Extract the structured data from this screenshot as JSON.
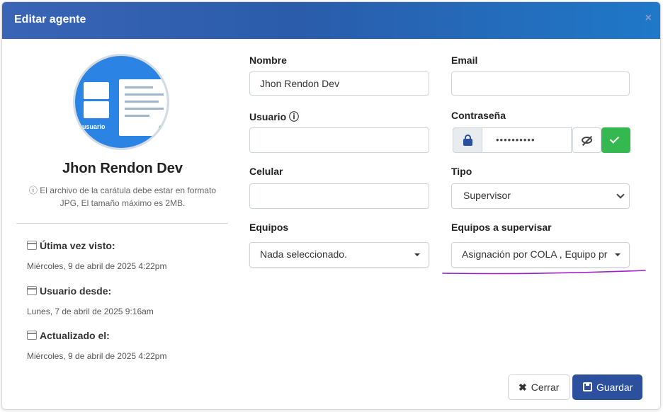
{
  "modal": {
    "title": "Editar agente",
    "close_glyph": "×"
  },
  "profile": {
    "avatar_caption": "usuario",
    "name": "Jhon Rendon Dev",
    "note": "El archivo de la carátula debe estar en formato JPG, El tamaño máximo es 2MB."
  },
  "meta": {
    "last_seen_label": "Útima vez visto:",
    "last_seen_value": "Miércoles, 9 de abril de 2025 4:22pm",
    "since_label": "Usuario desde:",
    "since_value": "Lunes, 7 de abril de 2025 9:16am",
    "updated_label": "Actualizado el:",
    "updated_value": "Miércoles, 9 de abril de 2025 4:22pm"
  },
  "form": {
    "nombre_label": "Nombre",
    "nombre_value": "Jhon Rendon Dev",
    "email_label": "Email",
    "email_value": "",
    "usuario_label": "Usuario",
    "usuario_value": "",
    "contrasena_label": "Contraseña",
    "contrasena_value": "••••••••••",
    "celular_label": "Celular",
    "celular_value": "",
    "tipo_label": "Tipo",
    "tipo_value": "Supervisor",
    "equipos_label": "Equipos",
    "equipos_value": "Nada seleccionado.",
    "equipos_supervisar_label": "Equipos a supervisar",
    "equipos_supervisar_value": "Asignación por COLA , Equipo pr"
  },
  "footer": {
    "close_label": "Cerrar",
    "save_label": "Guardar"
  },
  "colors": {
    "header_start": "#3a64b6",
    "header_end": "#1f78c8",
    "save_button": "#2c4f9e",
    "confirm_button": "#35b84f",
    "underline": "#a020c8"
  }
}
